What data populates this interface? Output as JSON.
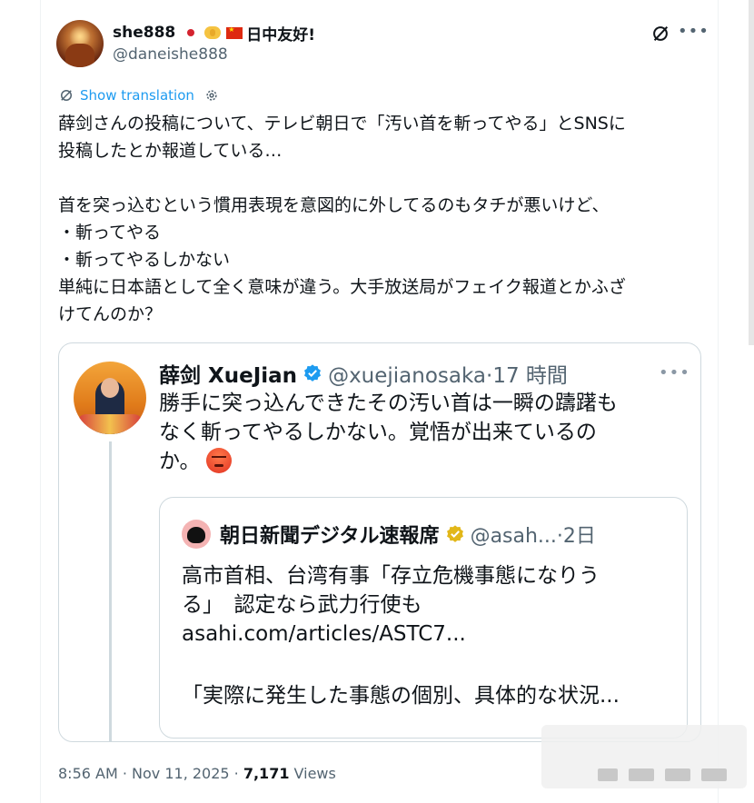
{
  "author": {
    "display_name": "she888",
    "name_suffix": "日中友好!",
    "handle": "@daneishe888"
  },
  "icons": {
    "flags": [
      "japan-flag-icon",
      "handshake-icon",
      "china-flag-icon"
    ],
    "grok": "grok-icon",
    "more": "more-icon",
    "translate": "globe-icon",
    "settings": "gear-icon",
    "verified": "verified-badge-icon",
    "angry": "angry-face-icon"
  },
  "translation": {
    "label": "Show translation"
  },
  "tweet": {
    "lines": [
      "薛剑さんの投稿について、テレビ朝日で「汚い首を斬ってやる」とSNSに",
      "投稿したとか報道している…",
      "",
      "首を突っ込むという慣用表現を意図的に外してるのもタチが悪いけど、",
      "・斬ってやる",
      "・斬ってやるしかない",
      "単純に日本語として全く意味が違う。大手放送局がフェイク報道とかふざ",
      "けてんのか？"
    ]
  },
  "quote": {
    "name": "薛剑 XueJian",
    "handle_time": "@xuejianosaka·17 時間",
    "lines": [
      "勝手に突っ込んできたその汚い首は一瞬の躊躇も",
      "なく斬ってやるしかない。覚悟が出来ているの",
      "か。"
    ]
  },
  "nested_quote": {
    "name": "朝日新聞デジタル速報席",
    "handle_time": "@asah...·2日",
    "lines": [
      "高市首相、台湾有事「存立危機事態になりう",
      "る」　認定なら武力行使も",
      "asahi.com/articles/ASTC7..."
    ],
    "excerpt": "「実際に発生した事態の個別、具体的な状況..."
  },
  "footer": {
    "time": "8:56 AM · Nov 11, 2025 · ",
    "views_count": "7,171",
    "views_label": " Views"
  },
  "colors": {
    "link_blue": "#1d9bf0",
    "verified_blue": "#1d9bf0",
    "gold": "#e2b719",
    "secondary_text": "#536471",
    "border": "#cfd9de"
  }
}
